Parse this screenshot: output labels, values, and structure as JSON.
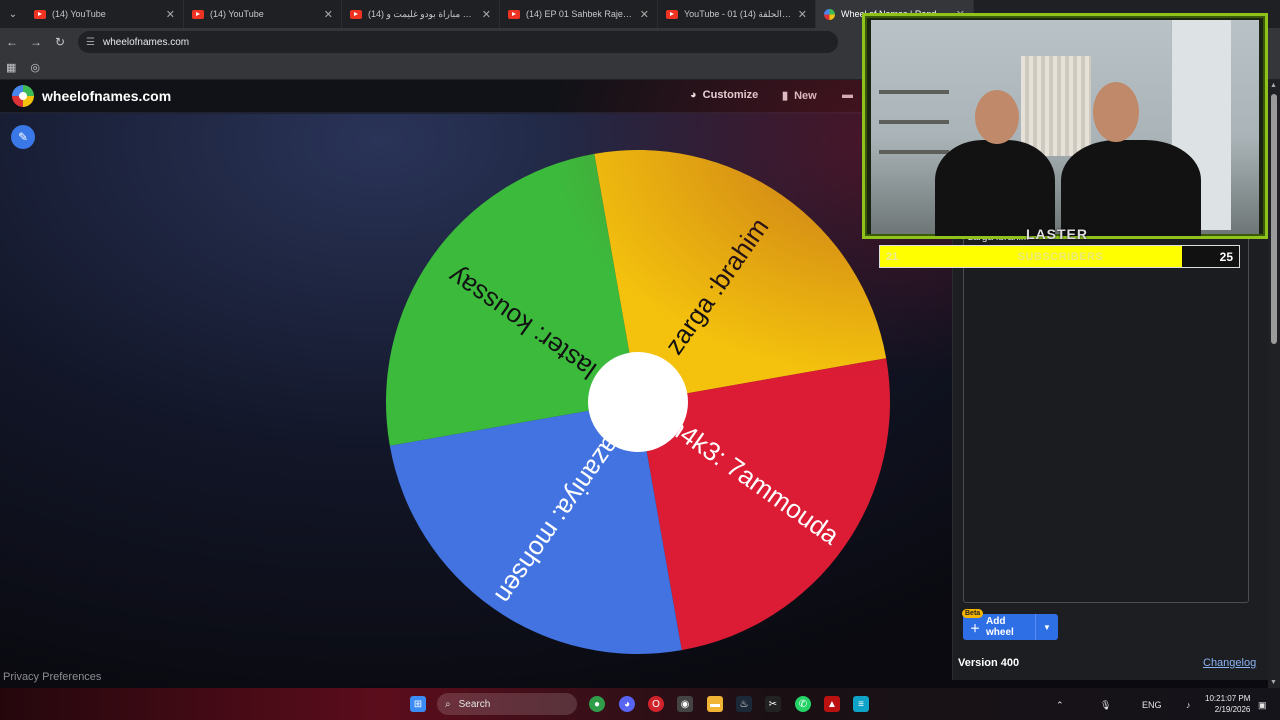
{
  "browser": {
    "tabs": [
      {
        "title": "(14) YouTube",
        "icon": "youtube-icon",
        "active": false
      },
      {
        "title": "(14) YouTube",
        "icon": "youtube-icon",
        "active": false
      },
      {
        "title": "(14) ملخص مباراة بودو غليمت و...",
        "icon": "youtube-icon",
        "active": false
      },
      {
        "title": "(14) EP 01 Sahbek Rajel 2 | 2 ...",
        "icon": "youtube-icon",
        "active": false
      },
      {
        "title": "YouTube - 01 كلاش | الحلقة (14)",
        "icon": "youtube-icon",
        "active": false
      },
      {
        "title": "Wheel of Names | Random...",
        "icon": "wheel-favicon",
        "active": true
      }
    ],
    "url": "wheelofnames.com"
  },
  "app": {
    "brand": "wheelofnames.com",
    "nav": {
      "customize": "Customize",
      "new": "New"
    },
    "privacy": "Privacy Preferences",
    "wheel": {
      "segments": [
        {
          "label": "zarga :brahim",
          "color": "#f4c20d"
        },
        {
          "label": "h4k3: 7ammouda",
          "color": "#db1c34"
        },
        {
          "label": "lazaniya: mohsen",
          "color": "#4273e0"
        },
        {
          "label": "laster: koussay",
          "color": "#3cba3c"
        }
      ]
    },
    "sidebar": {
      "entry_partial": "zarga :brahi...",
      "beta": "Beta",
      "add_wheel": "Add wheel",
      "version": "Version 400",
      "changelog": "Changelog"
    }
  },
  "overlay": {
    "sub_start": "21",
    "sub_label": "SUBSCRIBERS",
    "sub_goal": "25",
    "sub_progress": 0.84,
    "cam_logo": "LASTER"
  },
  "taskbar": {
    "search": "Search",
    "lang": "ENG",
    "time": "10:21:07 PM",
    "date": "2/19/2026"
  }
}
